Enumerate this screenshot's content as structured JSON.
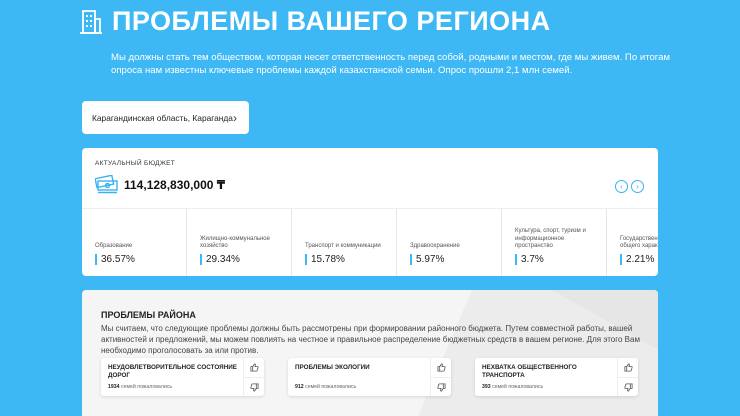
{
  "header": {
    "title": "ПРОБЛЕМЫ ВАШЕГО РЕГИОНА",
    "icon": "building-icon",
    "lead": "Мы должны стать тем обществом, которая несет ответственность перед собой, родными и местом, где мы живем. По итогам опроса нам известны ключевые проблемы каждой казахстанской семьи. Опрос прошли 2,1 млн семей."
  },
  "region": {
    "label": "Карагандинская область, Караганда",
    "icon": "chevron-right-icon"
  },
  "budget": {
    "label": "АКТУАЛЬНЫЙ БЮДЖЕТ",
    "amount": "114,128,830,000 ₸",
    "icon": "money-stack-icon",
    "prev": "‹",
    "next": "›",
    "categories": [
      {
        "name": "Образование",
        "value": "36.57%"
      },
      {
        "name": "Жилищно-коммунальное хозяйство",
        "value": "29.34%"
      },
      {
        "name": "Транспорт и коммуникации",
        "value": "15.78%"
      },
      {
        "name": "Здравоохранение",
        "value": "5.97%"
      },
      {
        "name": "Культура, спорт, туризм и информационное пространство",
        "value": "3.7%"
      },
      {
        "name": "Государственные услуги общего характера",
        "value": "2.21%"
      }
    ]
  },
  "problems": {
    "title": "ПРОБЛЕМЫ РАЙОНА",
    "description": "Мы считаем, что следующие проблемы должны быть рассмотрены при формировании районного бюджета. Путем совместной работы, вашей активностей и предложений, мы можем повлиять на честное и правильное распределение бюджетных средств в вашем регионе. Для этого Вам необходимо проголосовать за или против.",
    "items": [
      {
        "title": "НЕУДОВЛЕТВОРИТЕЛЬНОЕ СОСТОЯНИЕ ДОРОГ",
        "count": "1934",
        "suffix": "семей пожаловались"
      },
      {
        "title": "ПРОБЛЕМЫ ЭКОЛОГИИ",
        "count": "912",
        "suffix": "семей пожаловались"
      },
      {
        "title": "НЕХВАТКА ОБЩЕСТВЕННОГО ТРАНСПОРТА",
        "count": "393",
        "suffix": "семей пожаловались"
      }
    ]
  },
  "colors": {
    "background": "#3db8f5",
    "accent": "#3db8f5",
    "card": "#ffffff"
  }
}
